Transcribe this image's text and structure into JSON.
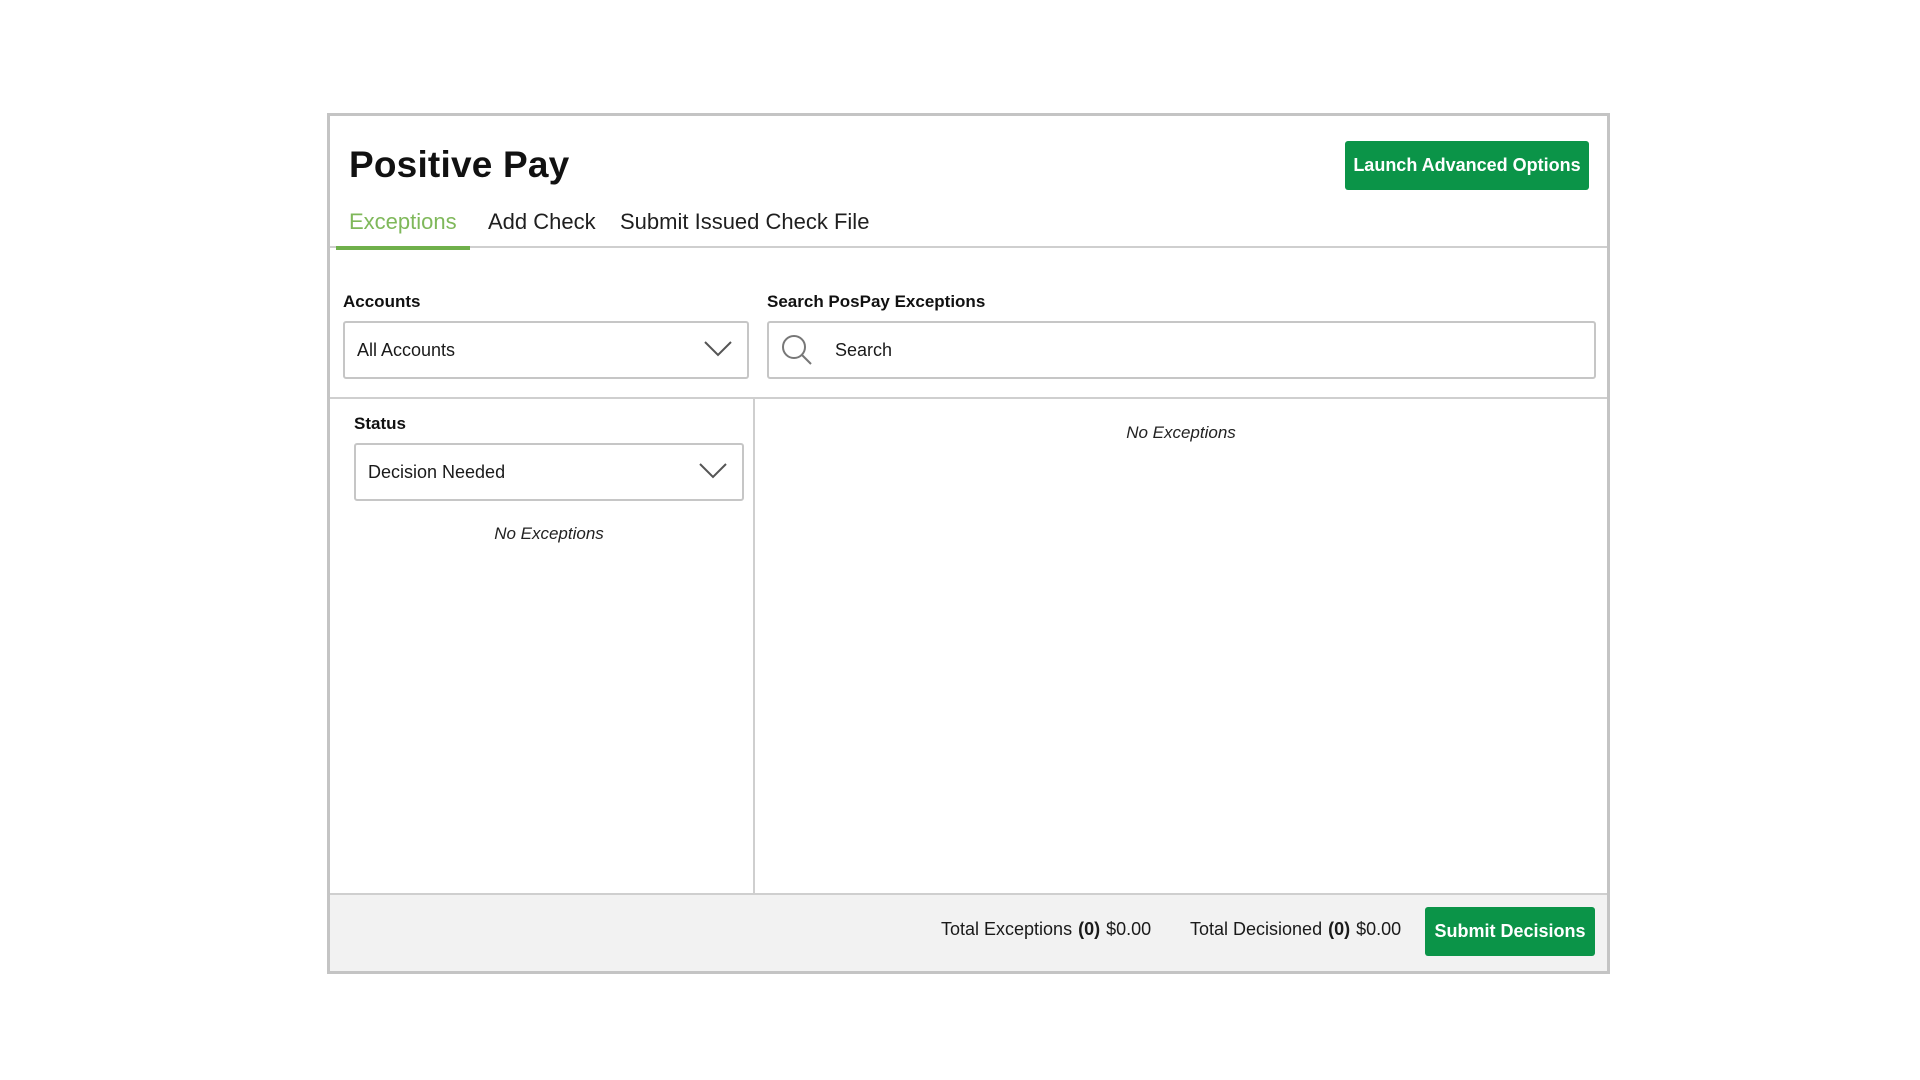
{
  "page": {
    "title": "Positive Pay",
    "launch_button": "Launch Advanced Options"
  },
  "tabs": [
    {
      "label": "Exceptions",
      "active": true
    },
    {
      "label": "Add Check",
      "active": false
    },
    {
      "label": "Submit Issued Check File",
      "active": false
    }
  ],
  "filters": {
    "accounts_label": "Accounts",
    "accounts_value": "All Accounts",
    "search_label": "Search PosPay Exceptions",
    "search_placeholder": "Search"
  },
  "left_panel": {
    "status_label": "Status",
    "status_value": "Decision Needed",
    "empty_message": "No Exceptions"
  },
  "right_panel": {
    "empty_message": "No Exceptions"
  },
  "footer": {
    "total_exceptions_label": "Total Exceptions",
    "total_exceptions_count": "(0)",
    "total_exceptions_amount": "$0.00",
    "total_decisioned_label": "Total Decisioned",
    "total_decisioned_count": "(0)",
    "total_decisioned_amount": "$0.00",
    "submit_button": "Submit Decisions"
  },
  "colors": {
    "accent_green": "#0b9448",
    "active_tab": "#7fb85a",
    "border": "#c4c4c4",
    "footer_bg": "#f2f2f2"
  },
  "icons": [
    "chevron-down-icon",
    "search-icon"
  ]
}
